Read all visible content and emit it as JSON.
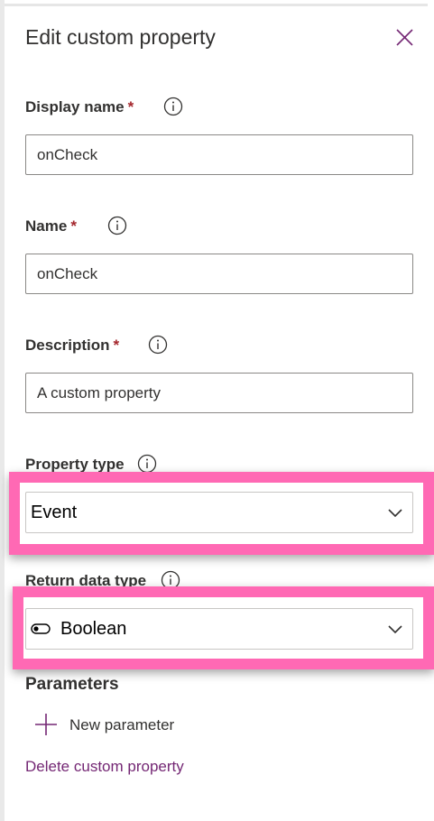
{
  "panel": {
    "title": "Edit custom property"
  },
  "fields": {
    "display_name": {
      "label": "Display name",
      "required_mark": "*",
      "value": "onCheck"
    },
    "name": {
      "label": "Name",
      "required_mark": "*",
      "value": "onCheck"
    },
    "description": {
      "label": "Description",
      "required_mark": "*",
      "value": "A custom property"
    },
    "property_type": {
      "label": "Property type",
      "selected": "Event"
    },
    "return_data_type": {
      "label": "Return data type",
      "selected": "Boolean",
      "icon": "toggle-icon"
    }
  },
  "parameters": {
    "heading": "Parameters",
    "add_label": "New parameter",
    "add_icon": "plus-icon"
  },
  "actions": {
    "delete_label": "Delete custom property"
  },
  "colors": {
    "highlight": "#ff69b4",
    "required": "#a4262c",
    "link": "#742774",
    "accent": "#742774"
  }
}
